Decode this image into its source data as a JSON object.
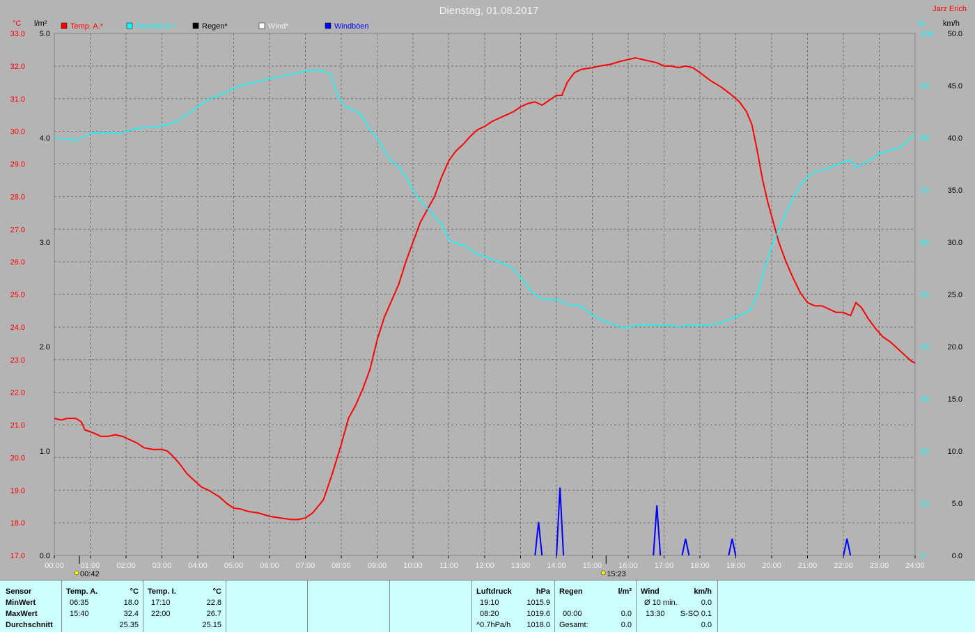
{
  "header": {
    "title": "Dienstag, 01.08.2017",
    "author": "Jarz Erich"
  },
  "legend": [
    {
      "label": "Temp. A.*",
      "color": "#ff0000"
    },
    {
      "label": "Feuchte A.*",
      "color": "#00ffff"
    },
    {
      "label": "Regen*",
      "color": "#000000"
    },
    {
      "label": "Wind*",
      "color": "#ffffff"
    },
    {
      "label": "Windböen",
      "color": "#0000ff"
    }
  ],
  "axes": {
    "temp_unit": "°C",
    "rain_unit": "l/m²",
    "hum_unit": "%",
    "wind_unit": "km/h",
    "temp_ticks": [
      "17.0",
      "18.0",
      "19.0",
      "20.0",
      "21.0",
      "22.0",
      "23.0",
      "24.0",
      "25.0",
      "26.0",
      "27.0",
      "28.0",
      "29.0",
      "30.0",
      "31.0",
      "32.0",
      "33.0"
    ],
    "rain_ticks": [
      "0.0",
      "1.0",
      "2.0",
      "3.0",
      "4.0",
      "5.0"
    ],
    "hum_ticks": [
      "0",
      "10",
      "20",
      "30",
      "40",
      "50",
      "60",
      "70",
      "80",
      "90",
      "100"
    ],
    "wind_ticks": [
      "0.0",
      "5.0",
      "10.0",
      "15.0",
      "20.0",
      "25.0",
      "30.0",
      "35.0",
      "40.0",
      "45.0",
      "50.0"
    ],
    "x_ticks": [
      "00:00",
      "01:00",
      "02:00",
      "03:00",
      "04:00",
      "05:00",
      "06:00",
      "07:00",
      "08:00",
      "09:00",
      "10:00",
      "11:00",
      "12:00",
      "13:00",
      "14:00",
      "15:00",
      "16:00",
      "17:00",
      "18:00",
      "19:00",
      "20:00",
      "21:00",
      "22:00",
      "23:00",
      "24:00"
    ],
    "sunrise": "00:42",
    "sunset": "15:23"
  },
  "chart_data": {
    "type": "line",
    "x_unit": "hours",
    "xlim": [
      0,
      24
    ],
    "ylim_temp": [
      17,
      33
    ],
    "ylim_hum": [
      0,
      100
    ],
    "ylim_wind": [
      0,
      50
    ],
    "ylim_rain": [
      0,
      5
    ],
    "grid": true,
    "legend_position": "top",
    "series": [
      {
        "name": "Temp. A.*",
        "color": "#ff0000",
        "axis": "temp",
        "points": [
          [
            0,
            21.2
          ],
          [
            0.2,
            21.15
          ],
          [
            0.35,
            21.2
          ],
          [
            0.6,
            21.2
          ],
          [
            0.75,
            21.1
          ],
          [
            0.85,
            20.85
          ],
          [
            1.1,
            20.75
          ],
          [
            1.3,
            20.65
          ],
          [
            1.5,
            20.65
          ],
          [
            1.7,
            20.7
          ],
          [
            1.9,
            20.65
          ],
          [
            2.1,
            20.55
          ],
          [
            2.3,
            20.45
          ],
          [
            2.5,
            20.3
          ],
          [
            2.75,
            20.25
          ],
          [
            3.0,
            20.25
          ],
          [
            3.15,
            20.2
          ],
          [
            3.3,
            20.05
          ],
          [
            3.5,
            19.8
          ],
          [
            3.7,
            19.5
          ],
          [
            3.9,
            19.3
          ],
          [
            4.1,
            19.1
          ],
          [
            4.3,
            19.0
          ],
          [
            4.6,
            18.8
          ],
          [
            4.8,
            18.6
          ],
          [
            5.0,
            18.45
          ],
          [
            5.2,
            18.42
          ],
          [
            5.4,
            18.35
          ],
          [
            5.7,
            18.3
          ],
          [
            6.0,
            18.2
          ],
          [
            6.3,
            18.15
          ],
          [
            6.6,
            18.1
          ],
          [
            6.8,
            18.1
          ],
          [
            7.0,
            18.15
          ],
          [
            7.2,
            18.3
          ],
          [
            7.5,
            18.7
          ],
          [
            7.75,
            19.5
          ],
          [
            8.0,
            20.4
          ],
          [
            8.2,
            21.2
          ],
          [
            8.4,
            21.6
          ],
          [
            8.6,
            22.1
          ],
          [
            8.8,
            22.7
          ],
          [
            9.0,
            23.6
          ],
          [
            9.2,
            24.3
          ],
          [
            9.4,
            24.8
          ],
          [
            9.6,
            25.3
          ],
          [
            9.8,
            26.0
          ],
          [
            10.0,
            26.6
          ],
          [
            10.2,
            27.2
          ],
          [
            10.4,
            27.6
          ],
          [
            10.6,
            28.0
          ],
          [
            10.8,
            28.6
          ],
          [
            11.0,
            29.1
          ],
          [
            11.2,
            29.4
          ],
          [
            11.4,
            29.6
          ],
          [
            11.6,
            29.85
          ],
          [
            11.8,
            30.05
          ],
          [
            12.0,
            30.15
          ],
          [
            12.2,
            30.3
          ],
          [
            12.4,
            30.4
          ],
          [
            12.6,
            30.5
          ],
          [
            12.8,
            30.6
          ],
          [
            13.0,
            30.75
          ],
          [
            13.2,
            30.85
          ],
          [
            13.4,
            30.9
          ],
          [
            13.6,
            30.8
          ],
          [
            13.8,
            30.95
          ],
          [
            14.0,
            31.1
          ],
          [
            14.15,
            31.1
          ],
          [
            14.3,
            31.5
          ],
          [
            14.5,
            31.8
          ],
          [
            14.7,
            31.9
          ],
          [
            15.0,
            31.95
          ],
          [
            15.2,
            32.0
          ],
          [
            15.5,
            32.05
          ],
          [
            15.8,
            32.15
          ],
          [
            16.0,
            32.2
          ],
          [
            16.2,
            32.25
          ],
          [
            16.4,
            32.2
          ],
          [
            16.6,
            32.15
          ],
          [
            16.8,
            32.1
          ],
          [
            17.0,
            32.0
          ],
          [
            17.2,
            32.0
          ],
          [
            17.4,
            31.95
          ],
          [
            17.6,
            32.0
          ],
          [
            17.8,
            31.95
          ],
          [
            18.0,
            31.8
          ],
          [
            18.3,
            31.55
          ],
          [
            18.6,
            31.35
          ],
          [
            18.9,
            31.1
          ],
          [
            19.1,
            30.9
          ],
          [
            19.3,
            30.6
          ],
          [
            19.45,
            30.2
          ],
          [
            19.6,
            29.4
          ],
          [
            19.75,
            28.5
          ],
          [
            19.9,
            27.8
          ],
          [
            20.05,
            27.2
          ],
          [
            20.2,
            26.6
          ],
          [
            20.4,
            26.0
          ],
          [
            20.6,
            25.5
          ],
          [
            20.8,
            25.05
          ],
          [
            21.0,
            24.75
          ],
          [
            21.2,
            24.65
          ],
          [
            21.4,
            24.65
          ],
          [
            21.6,
            24.55
          ],
          [
            21.8,
            24.45
          ],
          [
            22.0,
            24.45
          ],
          [
            22.2,
            24.35
          ],
          [
            22.35,
            24.75
          ],
          [
            22.5,
            24.6
          ],
          [
            22.7,
            24.25
          ],
          [
            22.9,
            23.95
          ],
          [
            23.1,
            23.7
          ],
          [
            23.3,
            23.55
          ],
          [
            23.5,
            23.35
          ],
          [
            23.7,
            23.15
          ],
          [
            23.9,
            22.95
          ],
          [
            24.0,
            22.9
          ]
        ]
      },
      {
        "name": "Feuchte A.*",
        "color": "#00ffff",
        "axis": "hum",
        "points": [
          [
            0,
            80
          ],
          [
            0.3,
            79.8
          ],
          [
            0.6,
            79.5
          ],
          [
            0.8,
            80.2
          ],
          [
            1.0,
            80.8
          ],
          [
            1.3,
            81
          ],
          [
            1.6,
            81
          ],
          [
            1.8,
            80.8
          ],
          [
            2.0,
            81.2
          ],
          [
            2.3,
            81.8
          ],
          [
            2.6,
            82
          ],
          [
            2.9,
            82.2
          ],
          [
            3.2,
            82.6
          ],
          [
            3.5,
            83.5
          ],
          [
            3.8,
            85
          ],
          [
            4.1,
            86.5
          ],
          [
            4.4,
            87.6
          ],
          [
            4.7,
            88.5
          ],
          [
            5.0,
            89.5
          ],
          [
            5.3,
            90.2
          ],
          [
            5.6,
            90.7
          ],
          [
            6.0,
            91.3
          ],
          [
            6.4,
            91.9
          ],
          [
            6.8,
            92.5
          ],
          [
            7.0,
            92.8
          ],
          [
            7.3,
            93
          ],
          [
            7.5,
            92.8
          ],
          [
            7.7,
            92.2
          ],
          [
            7.9,
            88
          ],
          [
            8.1,
            86
          ],
          [
            8.4,
            85.2
          ],
          [
            8.6,
            84
          ],
          [
            8.8,
            81.5
          ],
          [
            9.0,
            80
          ],
          [
            9.2,
            77.5
          ],
          [
            9.4,
            75.5
          ],
          [
            9.6,
            74.5
          ],
          [
            9.8,
            72.5
          ],
          [
            10.0,
            70
          ],
          [
            10.2,
            68
          ],
          [
            10.4,
            66.5
          ],
          [
            10.6,
            65
          ],
          [
            10.8,
            63.5
          ],
          [
            11.0,
            60.5
          ],
          [
            11.3,
            59.5
          ],
          [
            11.5,
            59.2
          ],
          [
            11.7,
            58
          ],
          [
            11.9,
            57.5
          ],
          [
            12.1,
            57
          ],
          [
            12.3,
            56.5
          ],
          [
            12.5,
            56
          ],
          [
            12.7,
            55.5
          ],
          [
            12.9,
            54
          ],
          [
            13.1,
            52.5
          ],
          [
            13.3,
            50.5
          ],
          [
            13.5,
            49.5
          ],
          [
            13.7,
            49
          ],
          [
            14.0,
            49
          ],
          [
            14.2,
            48.5
          ],
          [
            14.4,
            47.8
          ],
          [
            14.6,
            48
          ],
          [
            14.8,
            47.2
          ],
          [
            15.0,
            46
          ],
          [
            15.3,
            45
          ],
          [
            15.6,
            44.2
          ],
          [
            15.9,
            43.6
          ],
          [
            16.2,
            44
          ],
          [
            16.5,
            44.2
          ],
          [
            16.8,
            44
          ],
          [
            17.1,
            44.2
          ],
          [
            17.4,
            43.8
          ],
          [
            17.7,
            44.2
          ],
          [
            18.0,
            44
          ],
          [
            18.3,
            44.2
          ],
          [
            18.6,
            44.6
          ],
          [
            18.9,
            45.4
          ],
          [
            19.2,
            46.2
          ],
          [
            19.4,
            47
          ],
          [
            19.6,
            50
          ],
          [
            19.8,
            55
          ],
          [
            20.0,
            59
          ],
          [
            20.2,
            62.5
          ],
          [
            20.4,
            65.5
          ],
          [
            20.6,
            68.5
          ],
          [
            20.8,
            71
          ],
          [
            21.0,
            72.5
          ],
          [
            21.2,
            73.5
          ],
          [
            21.5,
            74
          ],
          [
            21.8,
            74.8
          ],
          [
            22.0,
            75.3
          ],
          [
            22.2,
            75.8
          ],
          [
            22.35,
            74.2
          ],
          [
            22.5,
            74.8
          ],
          [
            22.8,
            76
          ],
          [
            23.0,
            77
          ],
          [
            23.3,
            77.6
          ],
          [
            23.6,
            78.2
          ],
          [
            23.8,
            79.5
          ],
          [
            24.0,
            80.5
          ]
        ]
      }
    ],
    "gusts": {
      "name": "Windböen",
      "color": "#0000ff",
      "axis": "wind",
      "unit": "km/h",
      "peaks": [
        [
          13.5,
          3.2
        ],
        [
          14.1,
          6.5
        ],
        [
          16.8,
          4.8
        ],
        [
          17.6,
          1.6
        ],
        [
          18.9,
          1.6
        ],
        [
          22.1,
          1.6
        ]
      ]
    }
  },
  "table": {
    "sensor": {
      "head": "Sensor",
      "min": "MinWert",
      "max": "MaxWert",
      "avg": "Durchschnitt"
    },
    "temp_a": {
      "head": "Temp. A.",
      "unit": "°C",
      "min_time": "06:35",
      "min": "18.0",
      "max_time": "15:40",
      "max": "32.4",
      "avg": "25.35"
    },
    "temp_i": {
      "head": "Temp. I.",
      "unit": "°C",
      "min_time": "17:10",
      "min": "22.8",
      "max_time": "22:00",
      "max": "26.7",
      "avg": "25.15"
    },
    "pressure": {
      "head": "Luftdruck",
      "unit": "hPa",
      "min_time": "19:10",
      "min": "1015.9",
      "max_time": "08:20",
      "max": "1019.6",
      "trend": "^0.7hPa/h",
      "avg": "1018.0"
    },
    "rain": {
      "head": "Regen",
      "unit": "l/m²",
      "max_time": "00:00",
      "max": "0.0",
      "total_label": "Gesamt:",
      "total": "0.0"
    },
    "wind": {
      "head": "Wind",
      "unit": "km/h",
      "avg_label": "Ø 10 min.",
      "avg": "0.0",
      "max_time": "13:30",
      "max": "S-SO 0.1",
      "total": "0.0"
    }
  }
}
